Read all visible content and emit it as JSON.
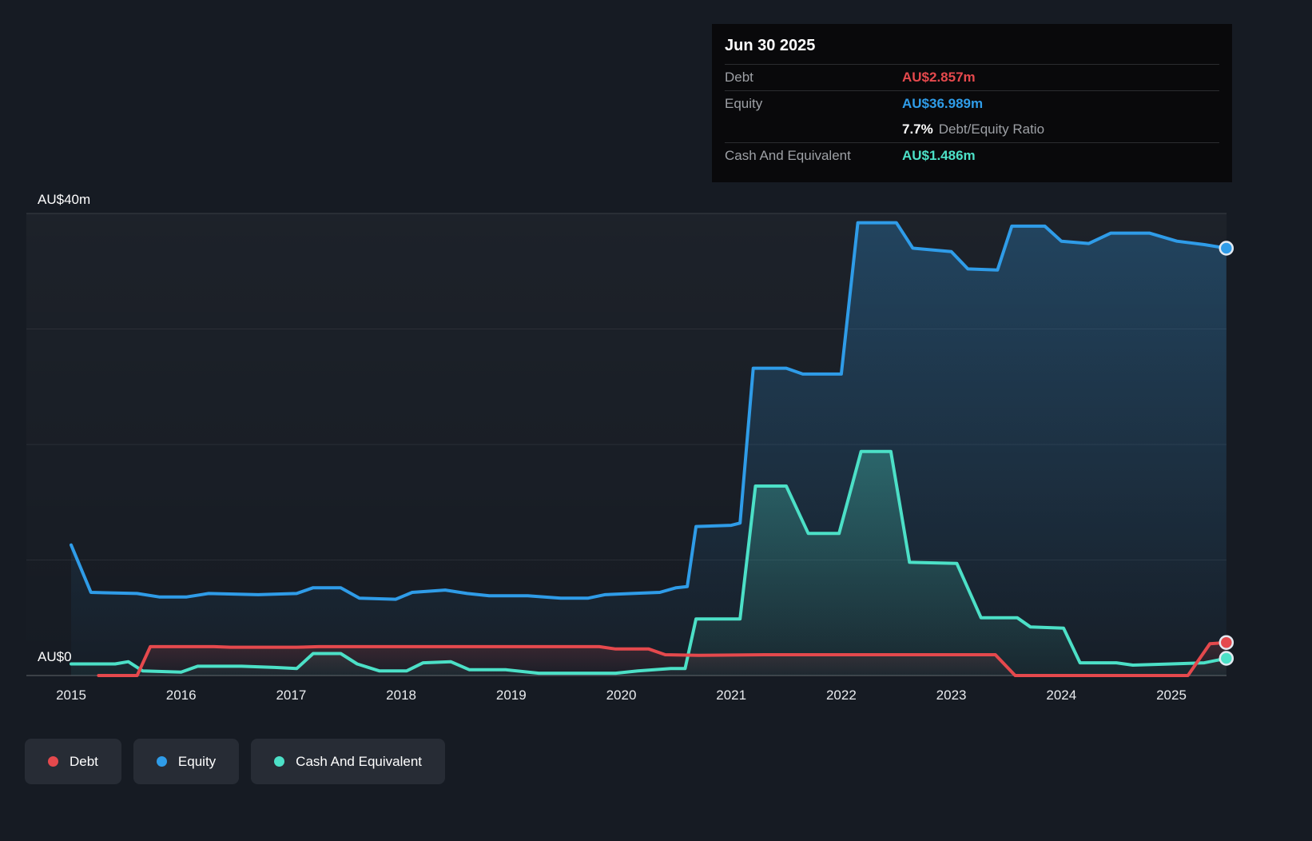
{
  "tooltip": {
    "date": "Jun 30 2025",
    "debt_label": "Debt",
    "debt_value": "AU$2.857m",
    "equity_label": "Equity",
    "equity_value": "AU$36.989m",
    "ratio_value": "7.7%",
    "ratio_label": "Debt/Equity Ratio",
    "cash_label": "Cash And Equivalent",
    "cash_value": "AU$1.486m"
  },
  "y_axis": {
    "top_label": "AU$40m",
    "zero_label": "AU$0"
  },
  "x_axis_years": [
    "2015",
    "2016",
    "2017",
    "2018",
    "2019",
    "2020",
    "2021",
    "2022",
    "2023",
    "2024",
    "2025"
  ],
  "legend": {
    "items": [
      {
        "label": "Debt",
        "color": "#e5494d"
      },
      {
        "label": "Equity",
        "color": "#2f9ce8"
      },
      {
        "label": "Cash And Equivalent",
        "color": "#4ce0c7"
      }
    ]
  },
  "colors": {
    "background": "#161b23",
    "tooltip_background": "#09090b",
    "legend_pill": "#272c35",
    "gridline": "#ffffff"
  },
  "chart_data": {
    "type": "line",
    "unit": "AU$ millions",
    "ylim": [
      0,
      40
    ],
    "y_gridlines": [
      0,
      10,
      20,
      30,
      40
    ],
    "x_tick_years": [
      2015,
      2016,
      2017,
      2018,
      2019,
      2020,
      2021,
      2022,
      2023,
      2024,
      2025
    ],
    "grid": true,
    "legend_position": "bottom-left",
    "series": [
      {
        "name": "Debt",
        "color": "#e5494d",
        "fill_opacity_top": 0.18,
        "fill_opacity_bottom": 0.02,
        "points": [
          [
            2015.25,
            0
          ],
          [
            2015.6,
            0
          ],
          [
            2015.72,
            2.5
          ],
          [
            2016.3,
            2.5
          ],
          [
            2016.45,
            2.45
          ],
          [
            2017.05,
            2.45
          ],
          [
            2017.25,
            2.5
          ],
          [
            2019.8,
            2.5
          ],
          [
            2019.95,
            2.3
          ],
          [
            2020.25,
            2.3
          ],
          [
            2020.4,
            1.8
          ],
          [
            2020.7,
            1.75
          ],
          [
            2021.3,
            1.8
          ],
          [
            2023.4,
            1.8
          ],
          [
            2023.58,
            0
          ],
          [
            2025.15,
            0
          ],
          [
            2025.35,
            2.75
          ],
          [
            2025.5,
            2.857
          ]
        ]
      },
      {
        "name": "Equity",
        "color": "#2f9ce8",
        "fill_opacity_top": 0.28,
        "fill_opacity_bottom": 0.02,
        "points": [
          [
            2015.0,
            11.3
          ],
          [
            2015.18,
            7.2
          ],
          [
            2015.6,
            7.1
          ],
          [
            2015.8,
            6.8
          ],
          [
            2016.05,
            6.8
          ],
          [
            2016.25,
            7.1
          ],
          [
            2016.7,
            7.0
          ],
          [
            2017.05,
            7.1
          ],
          [
            2017.2,
            7.6
          ],
          [
            2017.45,
            7.6
          ],
          [
            2017.62,
            6.7
          ],
          [
            2017.95,
            6.6
          ],
          [
            2018.1,
            7.2
          ],
          [
            2018.4,
            7.4
          ],
          [
            2018.6,
            7.1
          ],
          [
            2018.8,
            6.9
          ],
          [
            2019.15,
            6.9
          ],
          [
            2019.45,
            6.7
          ],
          [
            2019.7,
            6.7
          ],
          [
            2019.85,
            7.0
          ],
          [
            2020.1,
            7.1
          ],
          [
            2020.35,
            7.2
          ],
          [
            2020.5,
            7.6
          ],
          [
            2020.6,
            7.7
          ],
          [
            2020.68,
            12.9
          ],
          [
            2021.0,
            13.0
          ],
          [
            2021.08,
            13.2
          ],
          [
            2021.2,
            26.6
          ],
          [
            2021.5,
            26.6
          ],
          [
            2021.65,
            26.1
          ],
          [
            2022.0,
            26.1
          ],
          [
            2022.15,
            39.2
          ],
          [
            2022.5,
            39.2
          ],
          [
            2022.65,
            37.0
          ],
          [
            2023.0,
            36.7
          ],
          [
            2023.15,
            35.2
          ],
          [
            2023.42,
            35.1
          ],
          [
            2023.55,
            38.9
          ],
          [
            2023.85,
            38.9
          ],
          [
            2024.0,
            37.6
          ],
          [
            2024.25,
            37.4
          ],
          [
            2024.45,
            38.3
          ],
          [
            2024.8,
            38.3
          ],
          [
            2025.05,
            37.6
          ],
          [
            2025.3,
            37.3
          ],
          [
            2025.5,
            36.989
          ]
        ]
      },
      {
        "name": "Cash And Equivalent",
        "color": "#4ce0c7",
        "fill_opacity_top": 0.3,
        "fill_opacity_bottom": 0.05,
        "points": [
          [
            2015.0,
            1.0
          ],
          [
            2015.4,
            1.0
          ],
          [
            2015.52,
            1.2
          ],
          [
            2015.65,
            0.4
          ],
          [
            2016.0,
            0.3
          ],
          [
            2016.15,
            0.8
          ],
          [
            2016.55,
            0.8
          ],
          [
            2016.85,
            0.7
          ],
          [
            2017.05,
            0.6
          ],
          [
            2017.2,
            1.9
          ],
          [
            2017.45,
            1.9
          ],
          [
            2017.6,
            1.0
          ],
          [
            2017.8,
            0.4
          ],
          [
            2018.05,
            0.4
          ],
          [
            2018.2,
            1.1
          ],
          [
            2018.45,
            1.2
          ],
          [
            2018.62,
            0.5
          ],
          [
            2018.95,
            0.5
          ],
          [
            2019.25,
            0.2
          ],
          [
            2019.95,
            0.2
          ],
          [
            2020.15,
            0.4
          ],
          [
            2020.45,
            0.6
          ],
          [
            2020.58,
            0.6
          ],
          [
            2020.68,
            4.9
          ],
          [
            2021.08,
            4.9
          ],
          [
            2021.22,
            16.4
          ],
          [
            2021.5,
            16.4
          ],
          [
            2021.7,
            12.3
          ],
          [
            2021.98,
            12.3
          ],
          [
            2022.18,
            19.4
          ],
          [
            2022.45,
            19.4
          ],
          [
            2022.62,
            9.8
          ],
          [
            2023.05,
            9.7
          ],
          [
            2023.27,
            5.0
          ],
          [
            2023.6,
            5.0
          ],
          [
            2023.72,
            4.2
          ],
          [
            2024.02,
            4.1
          ],
          [
            2024.17,
            1.1
          ],
          [
            2024.5,
            1.1
          ],
          [
            2024.65,
            0.9
          ],
          [
            2025.0,
            1.0
          ],
          [
            2025.3,
            1.1
          ],
          [
            2025.5,
            1.486
          ]
        ]
      }
    ],
    "latest": {
      "date": "Jun 30 2025",
      "debt": 2.857,
      "equity": 36.989,
      "cash_and_equivalent": 1.486,
      "debt_equity_ratio_pct": 7.7
    }
  }
}
